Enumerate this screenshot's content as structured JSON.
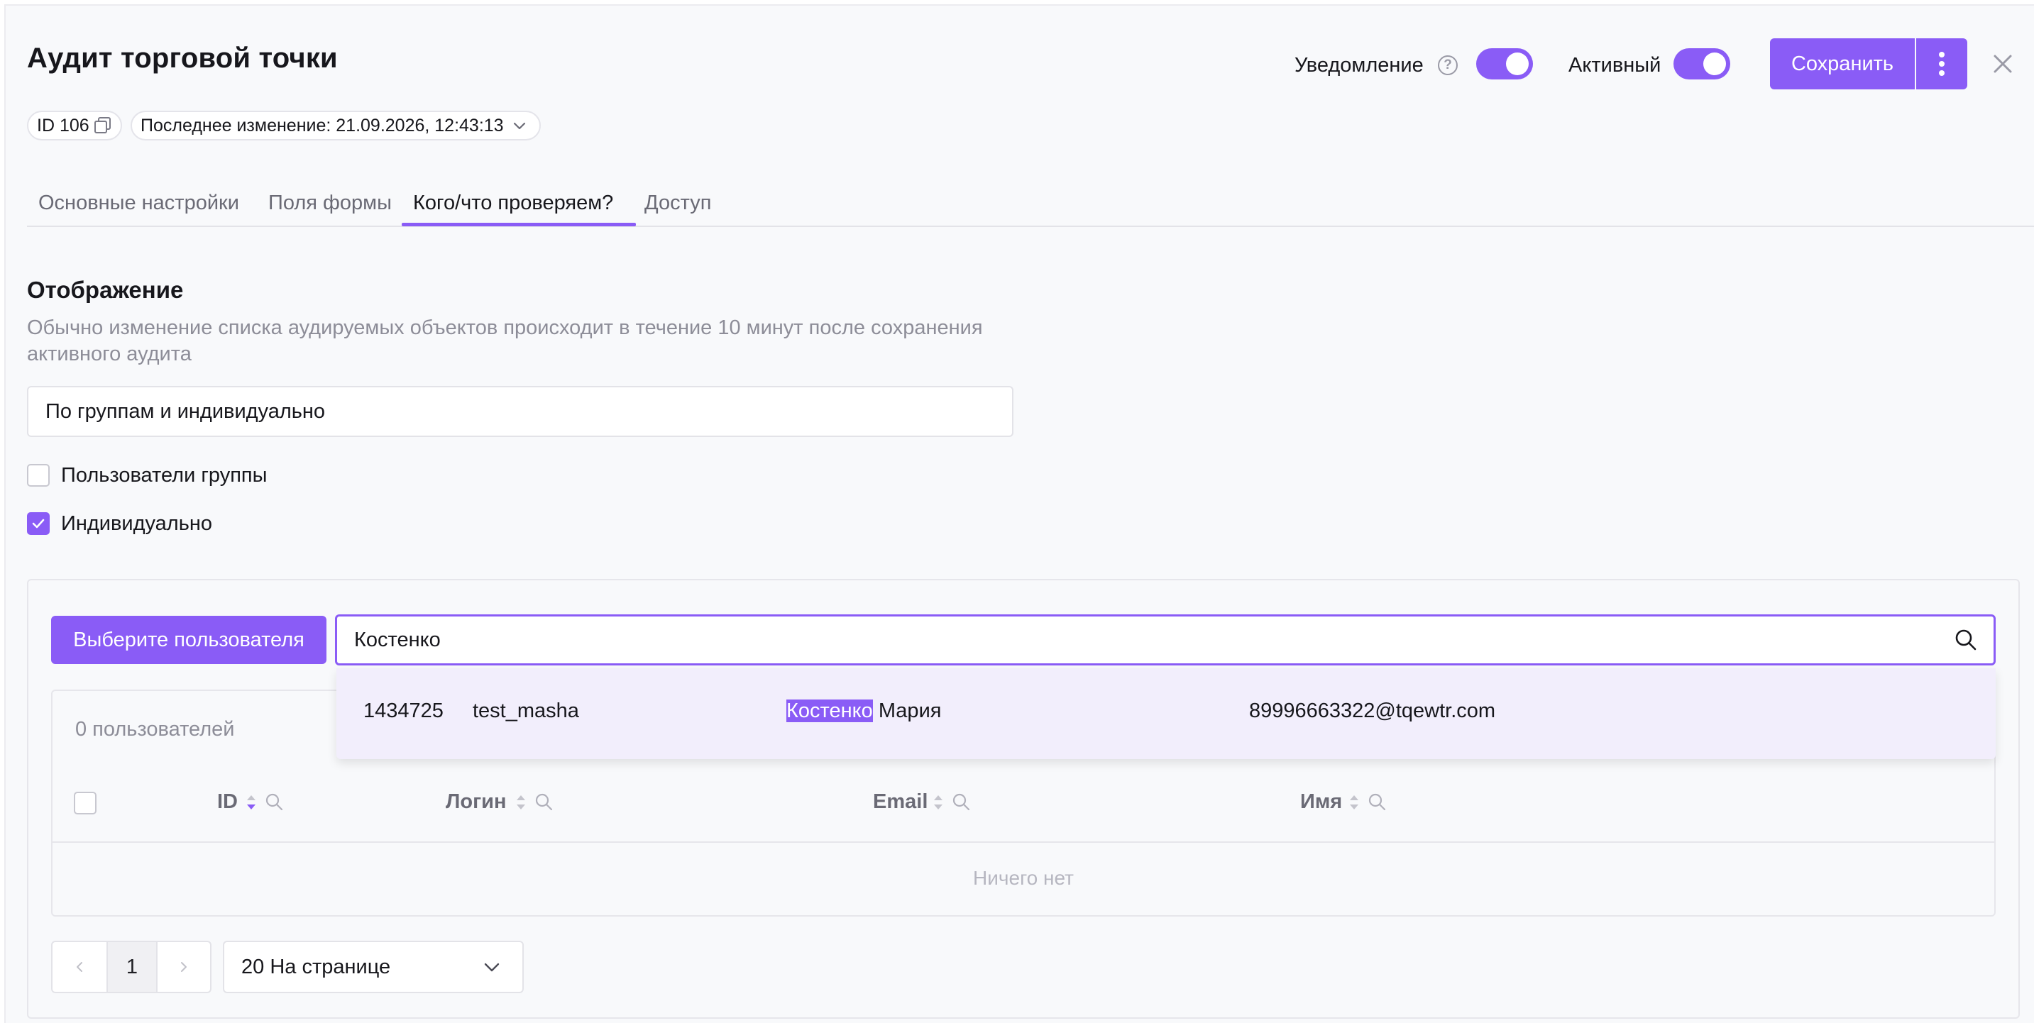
{
  "header": {
    "title": "Аудит торговой точки",
    "notification_label": "Уведомление",
    "active_label": "Активный",
    "save_label": "Сохранить",
    "notification_on": true,
    "active_on": true
  },
  "meta": {
    "id_label": "ID 106",
    "last_change": "Последнее изменение: 21.09.2026, 12:43:13"
  },
  "tabs": [
    {
      "label": "Основные настройки",
      "active": false
    },
    {
      "label": "Поля формы",
      "active": false
    },
    {
      "label": "Кого/что проверяем?",
      "active": true
    },
    {
      "label": "Доступ",
      "active": false
    }
  ],
  "display_section": {
    "title": "Отображение",
    "description": "Обычно изменение списка аудируемых объектов происходит в течение 10 минут после сохранения активного аудита",
    "mode_value": "По группам и индивидуально",
    "options": [
      {
        "label": "Пользователи группы",
        "checked": false
      },
      {
        "label": "Индивидуально",
        "checked": true
      }
    ]
  },
  "users_panel": {
    "choose_button": "Выберите пользователя",
    "search_value": "Костенко",
    "count_label": "0 пользователей",
    "columns": [
      "ID",
      "Логин",
      "Email",
      "Имя"
    ],
    "empty_text": "Ничего нет",
    "dropdown_result": {
      "id": "1434725",
      "login": "test_masha",
      "name_match": "Костенко",
      "name_rest": " Мария",
      "email": "89996663322@tqewtr.com"
    }
  },
  "pagination": {
    "page": "1",
    "per_page": "20 На странице"
  },
  "colors": {
    "accent": "#8a5cf6",
    "background": "#f8f9fb"
  }
}
